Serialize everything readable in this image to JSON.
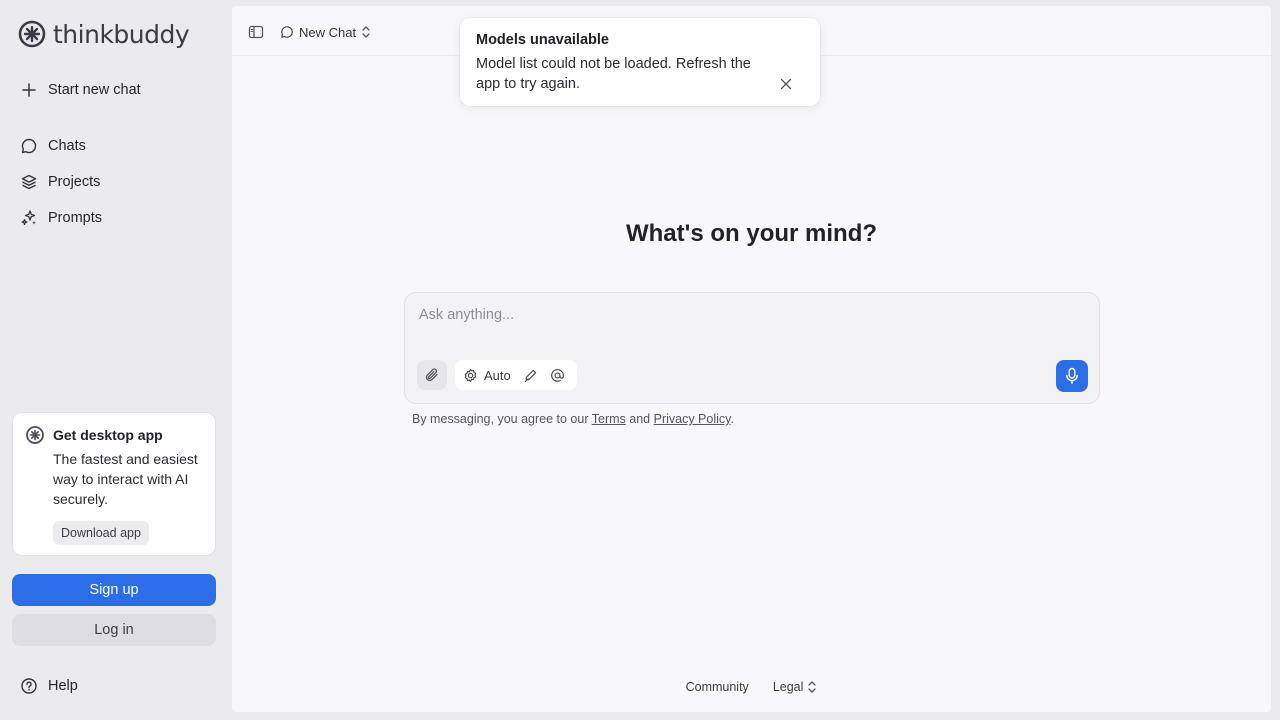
{
  "brand": {
    "name": "thinkbuddy"
  },
  "sidebar": {
    "start_new_chat": "Start new chat",
    "items": [
      {
        "label": "Chats",
        "icon": "chat-bubble-icon"
      },
      {
        "label": "Projects",
        "icon": "layers-icon"
      },
      {
        "label": "Prompts",
        "icon": "sparkles-icon"
      }
    ],
    "promo": {
      "title": "Get desktop app",
      "description": "The fastest and easiest way to interact with AI securely.",
      "button": "Download app"
    },
    "signup": "Sign up",
    "login": "Log in",
    "help": "Help"
  },
  "header": {
    "chat_selector": "New Chat"
  },
  "toast": {
    "title": "Models unavailable",
    "message": "Model list could not be loaded. Refresh the app to try again."
  },
  "main": {
    "heading": "What's on your mind?",
    "composer": {
      "placeholder": "Ask anything...",
      "model_label": "Auto"
    },
    "disclaimer": {
      "prefix": "By messaging, you agree to our",
      "terms": "Terms",
      "and": "and",
      "privacy": "Privacy Policy",
      "suffix": "."
    }
  },
  "footer": {
    "community": "Community",
    "legal": "Legal"
  },
  "colors": {
    "accent": "#2b6ee8",
    "sidebar_bg": "#ebebed",
    "main_bg": "#f8f8fa"
  }
}
